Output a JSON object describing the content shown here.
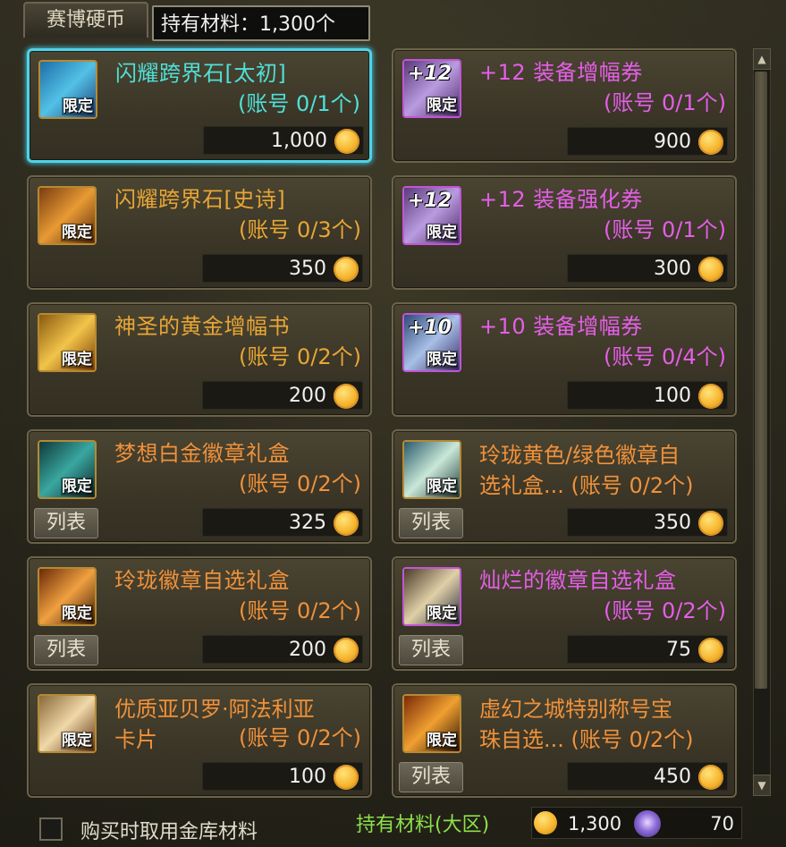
{
  "header": {
    "tab_label": "赛博硬币",
    "tooltip_text": "持有材料：1,300个"
  },
  "items": [
    {
      "name": "闪耀跨界石[太初]",
      "quota": "(账号 0/1个)",
      "price": "1,000",
      "limit": "限定",
      "color": "#4fe0d8",
      "selected": true,
      "has_list": false,
      "icon": "crystal-icon"
    },
    {
      "name": "+12 装备增幅券",
      "quota": "(账号 0/1个)",
      "price": "900",
      "limit": "限定",
      "color": "#e55ee8",
      "selected": false,
      "has_list": false,
      "icon": "plus12-ticket-icon",
      "badge": "+12"
    },
    {
      "name": "闪耀跨界石[史诗]",
      "quota": "(账号 0/3个)",
      "price": "350",
      "limit": "限定",
      "color": "#e8a636",
      "selected": false,
      "has_list": false,
      "icon": "crystal-epic-icon"
    },
    {
      "name": "+12 装备强化券",
      "quota": "(账号 0/1个)",
      "price": "300",
      "limit": "限定",
      "color": "#e55ee8",
      "selected": false,
      "has_list": false,
      "icon": "plus12-ticket-icon",
      "badge": "+12"
    },
    {
      "name": "神圣的黄金增幅书",
      "quota": "(账号 0/2个)",
      "price": "200",
      "limit": "限定",
      "color": "#e8a636",
      "selected": false,
      "has_list": false,
      "icon": "golden-book-icon"
    },
    {
      "name": "+10 装备增幅券",
      "quota": "(账号 0/4个)",
      "price": "100",
      "limit": "限定",
      "color": "#e55ee8",
      "selected": false,
      "has_list": false,
      "icon": "plus10-ticket-icon",
      "badge": "+10"
    },
    {
      "name": "梦想白金徽章礼盒",
      "quota": "(账号 0/2个)",
      "price": "325",
      "limit": "限定",
      "color": "#f0913a",
      "selected": false,
      "has_list": true,
      "icon": "platinum-badge-box-icon"
    },
    {
      "name": "玲珑黄色/绿色徽章自选礼盒...",
      "quota": "(账号 0/2个)",
      "price": "350",
      "limit": "限定",
      "color": "#f0913a",
      "selected": false,
      "has_list": true,
      "icon": "badge-box-icon",
      "two_line": true,
      "line1": "玲珑黄色/绿色徽章自",
      "line2": "选礼盒... (账号 0/2个)"
    },
    {
      "name": "玲珑徽章自选礼盒",
      "quota": "(账号 0/2个)",
      "price": "200",
      "limit": "限定",
      "color": "#f0913a",
      "selected": false,
      "has_list": true,
      "icon": "badge-select-box-icon"
    },
    {
      "name": "灿烂的徽章自选礼盒",
      "quota": "(账号 0/2个)",
      "price": "75",
      "limit": "限定",
      "color": "#e55ee8",
      "selected": false,
      "has_list": true,
      "icon": "brilliant-badge-box-icon"
    },
    {
      "name": "优质亚贝罗·阿法利亚卡片",
      "quota": "(账号 0/2个)",
      "price": "100",
      "limit": "限定",
      "color": "#f0913a",
      "selected": false,
      "has_list": false,
      "icon": "card-icon",
      "two_line": true,
      "line1": "优质亚贝罗·阿法利亚",
      "line2": "卡片"
    },
    {
      "name": "虚幻之城特别称号宝珠自选...",
      "quota": "(账号 0/2个)",
      "price": "450",
      "limit": "限定",
      "color": "#f0913a",
      "selected": false,
      "has_list": true,
      "icon": "title-orb-icon",
      "two_line": true,
      "line1": "虚幻之城特别称号宝",
      "line2": "珠自选... (账号 0/2个)"
    }
  ],
  "list_button_label": "列表",
  "footer": {
    "checkbox_label": "购买时取用金库材料",
    "owned_label": "持有材料(大区)",
    "owned_coins": "1,300",
    "owned_gems": "70"
  }
}
